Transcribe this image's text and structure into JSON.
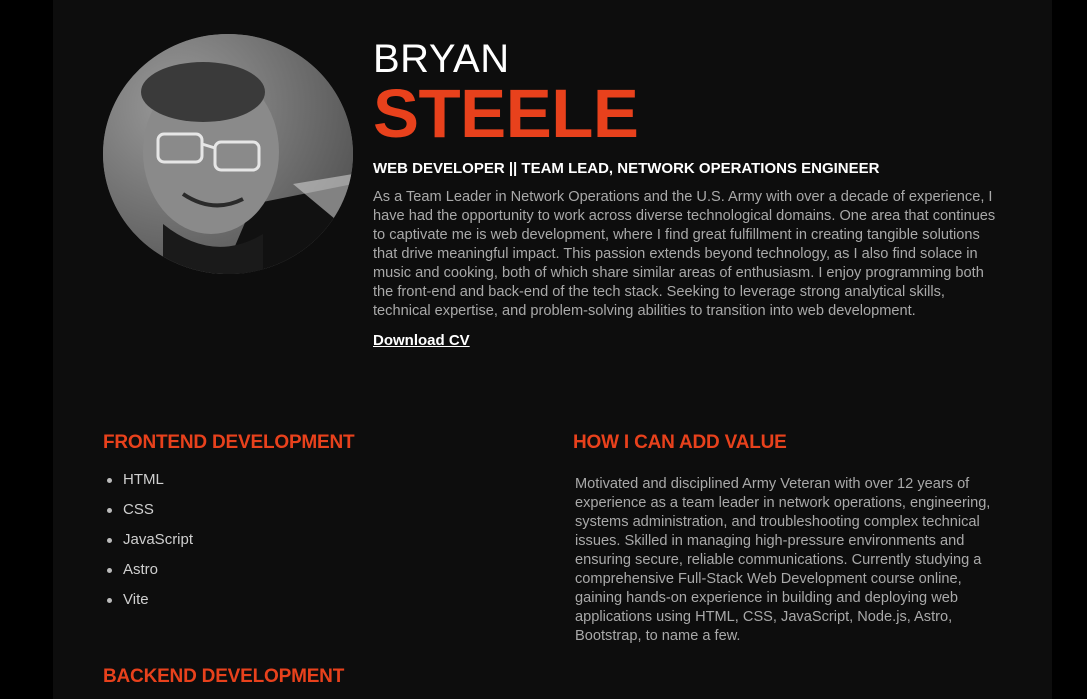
{
  "profile": {
    "first_name": "BRYAN",
    "last_name": "STEELE",
    "title": "WEB DEVELOPER || TEAM LEAD, NETWORK OPERATIONS ENGINEER",
    "bio": "As a Team Leader in Network Operations and the U.S. Army with over a decade of experience, I have had the opportunity to work across diverse technological domains. One area that continues to captivate me is web development, where I find great fulfillment in creating tangible solutions that drive meaningful impact. This passion extends beyond technology, as I also find solace in music and cooking, both of which share similar areas of enthusiasm. I enjoy programming both the front-end and back-end of the tech stack. Seeking to leverage strong analytical skills, technical expertise, and problem-solving abilities to transition into web development.",
    "download_label": "Download CV"
  },
  "frontend": {
    "heading": "FRONTEND DEVELOPMENT",
    "items": [
      "HTML",
      "CSS",
      "JavaScript",
      "Astro",
      "Vite"
    ]
  },
  "value": {
    "heading": "HOW I CAN ADD VALUE",
    "text": "Motivated and disciplined Army Veteran with over 12 years of experience as a team leader in network operations, engineering, systems administration, and troubleshooting complex technical issues. Skilled in managing high-pressure environments and ensuring secure, reliable communications. Currently studying a comprehensive Full-Stack Web Development course online, gaining hands-on experience in building and deploying web applications using HTML, CSS, JavaScript, Node.js, Astro, Bootstrap, to name a few."
  },
  "backend": {
    "heading": "BACKEND DEVELOPMENT"
  },
  "colors": {
    "accent": "#e8411c",
    "background": "#0d0d0d",
    "text_muted": "#a9a9a9"
  }
}
